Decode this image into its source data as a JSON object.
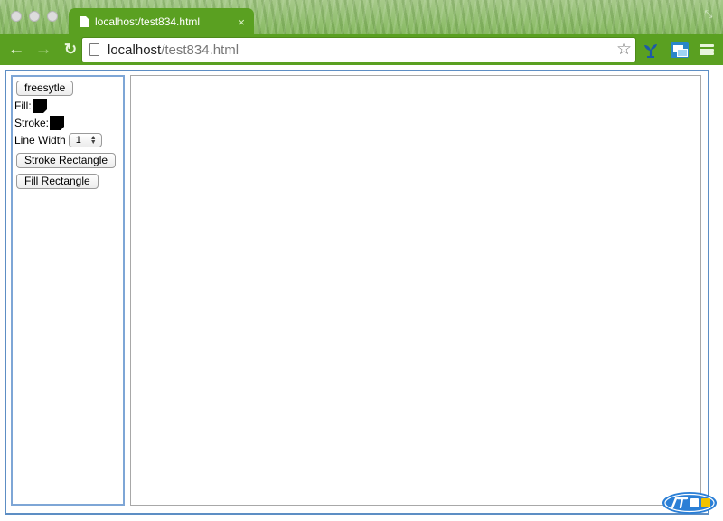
{
  "browser": {
    "tab_title": "localhost/test834.html",
    "tab_close": "×",
    "url_host": "localhost",
    "url_path": "/test834.html"
  },
  "panel": {
    "freestyle_label": "freesytle",
    "fill_label": "Fill:",
    "fill_color": "#000000",
    "stroke_label": "Stroke:",
    "stroke_color": "#000000",
    "line_width_label": "Line Width",
    "line_width_value": "1",
    "stroke_rect_label": "Stroke Rectangle",
    "fill_rect_label": "Fill Rectangle"
  },
  "colors": {
    "chrome_green": "#5aa021",
    "frame_blue": "#5d8ec4"
  },
  "icons": {
    "back": "back-arrow-icon",
    "forward": "forward-arrow-icon",
    "reload": "reload-icon",
    "star": "bookmark-star-icon",
    "menu": "hamburger-menu-icon"
  }
}
